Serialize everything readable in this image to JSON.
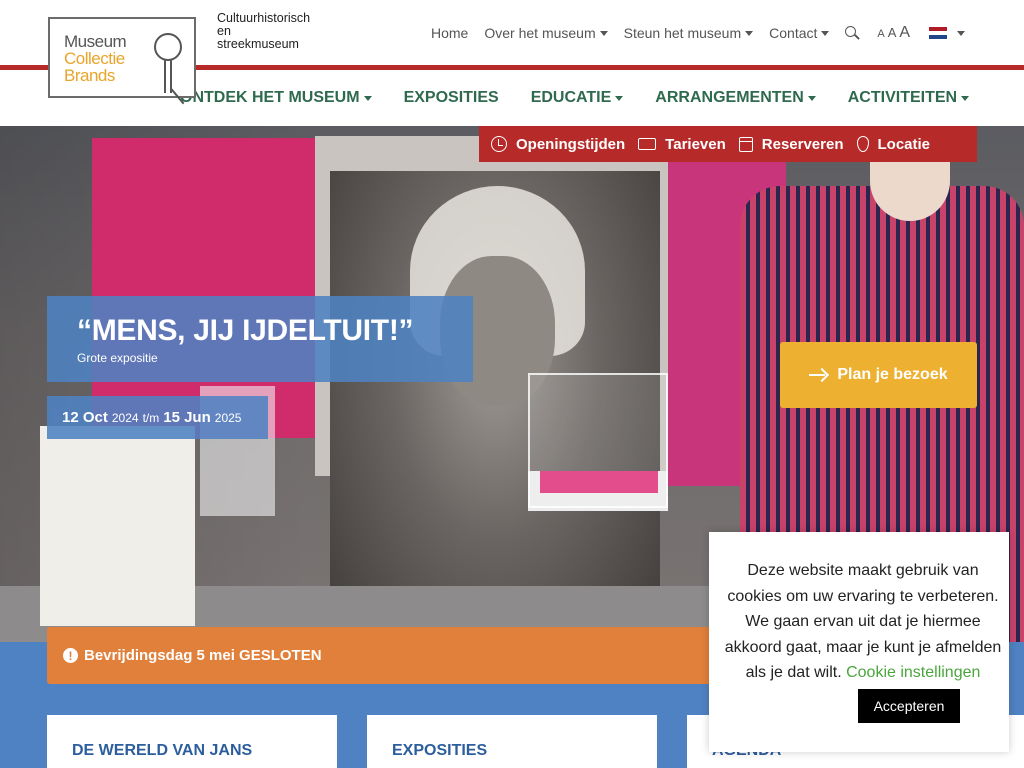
{
  "header": {
    "logo": {
      "line1": "Museum",
      "line2": "Collectie",
      "line3": "Brands"
    },
    "tagline": [
      "Cultuurhistorisch",
      "en",
      "streekmuseum"
    ],
    "topnav": [
      {
        "label": "Home",
        "dropdown": false
      },
      {
        "label": "Over het museum",
        "dropdown": true
      },
      {
        "label": "Steun het museum",
        "dropdown": true
      },
      {
        "label": "Contact",
        "dropdown": true
      }
    ],
    "fontsize": [
      "A",
      "A",
      "A"
    ],
    "flag_colors": [
      "#ae1c28",
      "#ffffff",
      "#21468b"
    ],
    "search_icon": "search-icon"
  },
  "mainnav": [
    {
      "label": "ONTDEK HET MUSEUM",
      "dropdown": true
    },
    {
      "label": "EXPOSITIES",
      "dropdown": false
    },
    {
      "label": "EDUCATIE",
      "dropdown": true
    },
    {
      "label": "ARRANGEMENTEN",
      "dropdown": true
    },
    {
      "label": "ACTIVITEITEN",
      "dropdown": true
    }
  ],
  "quicklinks": [
    {
      "label": "Openingstijden",
      "icon": "clock-icon"
    },
    {
      "label": "Tarieven",
      "icon": "ticket-icon"
    },
    {
      "label": "Reserveren",
      "icon": "calendar-icon"
    },
    {
      "label": "Locatie",
      "icon": "map-pin-icon"
    }
  ],
  "hero": {
    "title": "“MENS, JIJ IJDELTUIT!”",
    "subtitle": "Grote expositie",
    "date": {
      "start_day": "12 Oct",
      "start_year": "2024",
      "sep": "t/m",
      "end_day": "15 Jun",
      "end_year": "2025"
    },
    "cta": "Plan je bezoek"
  },
  "alert": {
    "text": "Bevrijdingsdag 5 mei GESLOTEN"
  },
  "cards": [
    {
      "title": "DE WERELD VAN JANS"
    },
    {
      "title": "EXPOSITIES"
    },
    {
      "title": "AGENDA"
    }
  ],
  "cookie": {
    "message": "Deze website maakt gebruik van cookies om uw ervaring te verbeteren. We gaan ervan uit dat je hiermee akkoord gaat, maar je kunt je afmelden als je dat wilt.",
    "settings_link": "Cookie instellingen",
    "accept": "Accepteren"
  },
  "colors": {
    "accent_red": "#b72a2a",
    "nav_green": "#2f6a4f",
    "blue": "#4f82c2",
    "orange": "#e1803b",
    "yellow": "#edb031"
  }
}
